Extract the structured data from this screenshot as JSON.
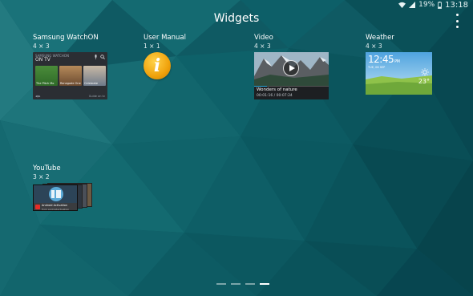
{
  "status_bar": {
    "battery_percent": "19%",
    "time": "13:18",
    "icons": [
      "wifi-icon",
      "signal-icon",
      "battery-icon"
    ]
  },
  "header": {
    "title": "Widgets",
    "menu_icon": "overflow-menu-icon"
  },
  "widgets": [
    {
      "name": "Samsung WatchON",
      "size": "4 × 3",
      "preview": {
        "header_text": "SAMSUNG WATCHON",
        "subtitle": "ON TV",
        "tiles": [
          "The Pitch Mo",
          "Renegade One",
          "Celebrate"
        ],
        "footer_right": "Guide on tv"
      }
    },
    {
      "name": "User Manual",
      "size": "1 × 1",
      "preview": {
        "glyph": "i",
        "icon": "info-icon"
      }
    },
    {
      "name": "Video",
      "size": "4 × 3",
      "preview": {
        "caption": "Wonders of nature",
        "time": "00:01:16 / 00:07:24",
        "progress": 0.17,
        "icon": "play-icon"
      }
    },
    {
      "name": "Weather",
      "size": "4 × 3",
      "preview": {
        "time": "12:45",
        "ampm": "PM",
        "date": "TUE, 06 SEP",
        "temperature": "23°",
        "icon": "sun-icon"
      }
    },
    {
      "name": "YouTube",
      "size": "3 × 2",
      "preview": {
        "title": "Android Activation",
        "subtitle": "from androidactivation"
      }
    }
  ],
  "pager": {
    "count": 4,
    "active": 3
  },
  "colors": {
    "accent": "#2aa7d8",
    "background": "#0d5a63",
    "info_icon": "#f0a20c",
    "youtube_red": "#e52d27"
  }
}
